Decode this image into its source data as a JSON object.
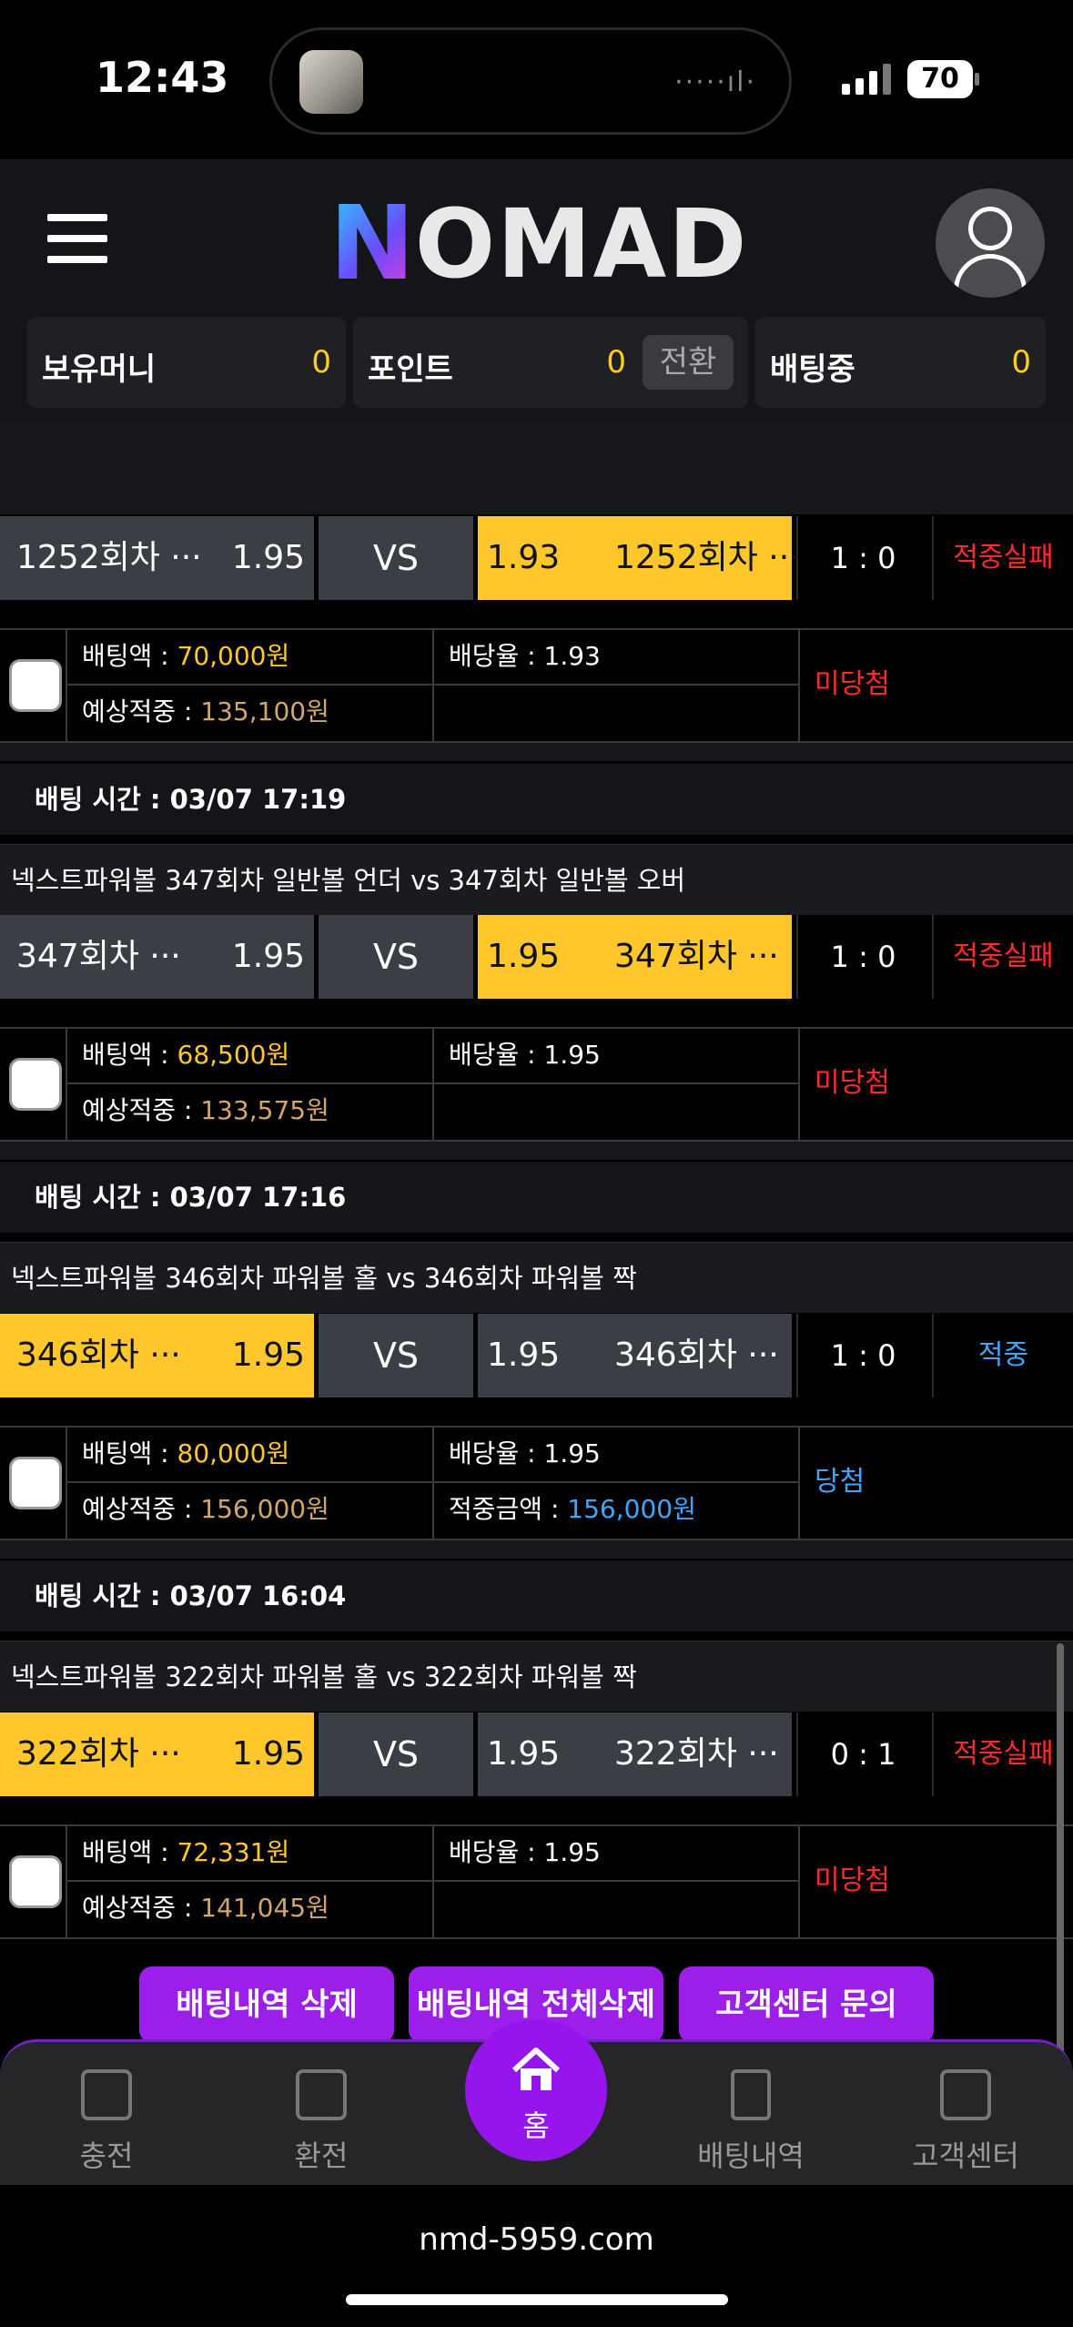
{
  "status_bar": {
    "time": "12:43",
    "battery": "70",
    "wave": "·····ıl·"
  },
  "header": {
    "logo_first": "N",
    "logo_rest": "OMAD",
    "balances": [
      {
        "label": "보유머니",
        "value": "0"
      },
      {
        "label": "포인트",
        "value": "0",
        "action": "전환"
      },
      {
        "label": "배팅중",
        "value": "0"
      }
    ]
  },
  "bets": [
    {
      "home": {
        "name": "1252회차 ···",
        "odds": "1.95"
      },
      "vs": "VS",
      "away": {
        "name": "1252회차 ···",
        "odds": "1.93"
      },
      "selected": "away",
      "score": "1 : 0",
      "result": "적중실패",
      "amount_label": "배팅액 : ",
      "amount": "70,000원",
      "odds_label": "배당율 : ",
      "odds": "1.93",
      "expected_label": "예상적중 : ",
      "expected": "135,100원",
      "win_label": "",
      "win_amount": "",
      "status": "미당첨"
    },
    {
      "time_label": "배팅 시간 : 03/07 17:19",
      "desc": "넥스트파워볼 347회차 일반볼 언더  vs  347회차 일반볼 오버",
      "home": {
        "name": "347회차 ···",
        "odds": "1.95"
      },
      "vs": "VS",
      "away": {
        "name": "347회차 ···",
        "odds": "1.95"
      },
      "selected": "away",
      "score": "1 : 0",
      "result": "적중실패",
      "amount_label": "배팅액 : ",
      "amount": "68,500원",
      "odds_label": "배당율 : ",
      "odds": "1.95",
      "expected_label": "예상적중 : ",
      "expected": "133,575원",
      "win_label": "",
      "win_amount": "",
      "status": "미당첨"
    },
    {
      "time_label": "배팅 시간 : 03/07 17:16",
      "desc": "넥스트파워볼 346회차 파워볼 홀  vs  346회차 파워볼 짝",
      "home": {
        "name": "346회차 ···",
        "odds": "1.95"
      },
      "vs": "VS",
      "away": {
        "name": "346회차 ···",
        "odds": "1.95"
      },
      "selected": "home",
      "score": "1 : 0",
      "result": "적중",
      "amount_label": "배팅액 : ",
      "amount": "80,000원",
      "odds_label": "배당율 : ",
      "odds": "1.95",
      "expected_label": "예상적중 : ",
      "expected": "156,000원",
      "win_label": "적중금액 : ",
      "win_amount": "156,000원",
      "status": "당첨"
    },
    {
      "time_label": "배팅 시간 : 03/07 16:04",
      "desc": "넥스트파워볼 322회차 파워볼 홀  vs  322회차 파워볼 짝",
      "home": {
        "name": "322회차 ···",
        "odds": "1.95"
      },
      "vs": "VS",
      "away": {
        "name": "322회차 ···",
        "odds": "1.95"
      },
      "selected": "home",
      "score": "0 : 1",
      "result": "적중실패",
      "amount_label": "배팅액 : ",
      "amount": "72,331원",
      "odds_label": "배당율 : ",
      "odds": "1.95",
      "expected_label": "예상적중 : ",
      "expected": "141,045원",
      "win_label": "",
      "win_amount": "",
      "status": "미당첨"
    }
  ],
  "actions": [
    "배팅내역 삭제",
    "배팅내역 전체삭제",
    "고객센터 문의"
  ],
  "nav": {
    "charge": "충전",
    "exchange": "환전",
    "home": "홈",
    "history": "배팅내역",
    "support": "고객센터"
  },
  "url": "nmd-5959.com",
  "colors": {
    "accent": "#9b1fe8",
    "selected": "#ffc72c",
    "fail": "#ff2a2a",
    "win": "#3ea6ff"
  }
}
